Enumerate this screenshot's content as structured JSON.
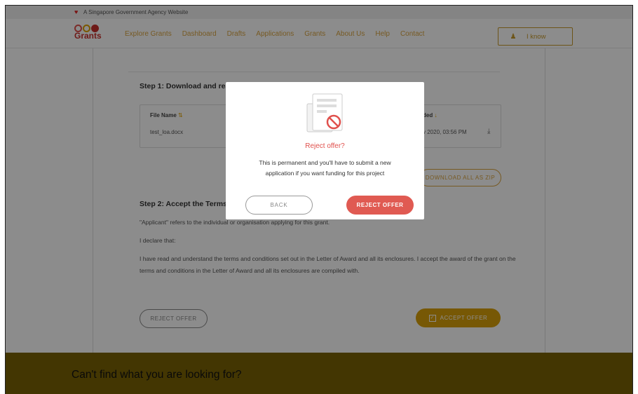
{
  "gov_bar": {
    "text": "A Singapore Government Agency Website"
  },
  "logo": {
    "text": "Grants"
  },
  "nav": {
    "items": [
      "Explore Grants",
      "Dashboard",
      "Drafts",
      "Applications",
      "Grants",
      "About Us",
      "Help",
      "Contact"
    ],
    "user_label": "I know"
  },
  "step1": {
    "title": "Step 1: Download and read",
    "col_file": "File Name",
    "col_uploaded": "ded",
    "file_name": "test_loa.docx",
    "uploaded_on": "v 2020, 03:56 PM",
    "download_all": "DOWNLOAD ALL AS ZIP"
  },
  "step2": {
    "title": "Step 2: Accept the Terms to",
    "applicant_def": "\"Applicant\" refers to the individual or organisation applying for this grant.",
    "declare": "I declare that:",
    "terms": "I have read and understand the terms and conditions set out in the Letter of Award and all its enclosures. I accept the award of the grant on the terms and conditions in the Letter of Award and all its enclosures are compiled with.",
    "reject_label": "REJECT OFFER",
    "accept_label": "ACCEPT OFFER"
  },
  "footer": {
    "question": "Can't find what you are looking for?"
  },
  "modal": {
    "icon": "document-reject-icon",
    "title": "Reject offer?",
    "message": "This is permanent and you'll have to submit a new application if you want funding for this project",
    "back_label": "BACK",
    "confirm_label": "REJECT OFFER"
  },
  "colors": {
    "accent_gold": "#d9a00a",
    "reject_red": "#e05a52",
    "footer_bg": "#d4aa09"
  }
}
